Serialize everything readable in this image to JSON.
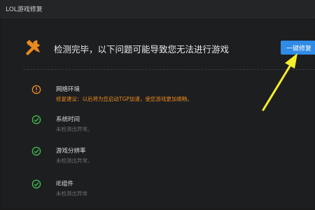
{
  "window": {
    "title": "LOL游戏修复"
  },
  "header": {
    "icon": "wrench-screwdriver-icon",
    "message": "检测完毕，以下问题可能导致您无法进行游戏",
    "fix_button_label": "一键修复"
  },
  "items": [
    {
      "name": "网络环境",
      "detail": "修复建议：以后将为您启动TGP加速，使您游戏更加顺畅。",
      "status": "warning",
      "icon": "warning-circle-icon"
    },
    {
      "name": "系统时间",
      "detail": "未检测出异常。",
      "status": "ok",
      "icon": "check-circle-icon"
    },
    {
      "name": "游戏分辨率",
      "detail": "未检测出异常。",
      "status": "ok",
      "icon": "check-circle-icon"
    },
    {
      "name": "IE组件",
      "detail": "未检测出异常",
      "status": "ok",
      "icon": "check-circle-icon"
    }
  ],
  "colors": {
    "accent": "#2f8be6",
    "warning": "#e8891e",
    "ok": "#3fb84e",
    "annotation_arrow": "#f4ee2b"
  }
}
